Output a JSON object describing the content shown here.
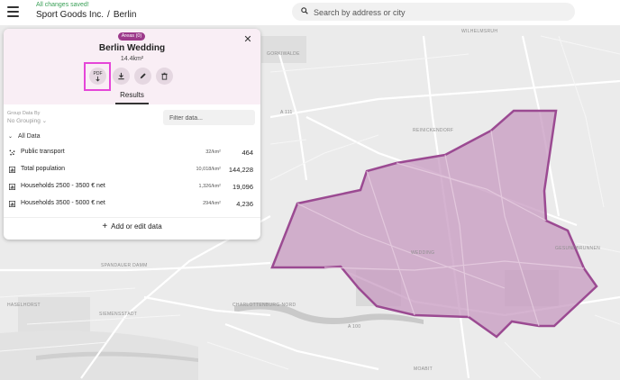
{
  "header": {
    "status": "All changes saved!",
    "company": "Sport Goods Inc.",
    "separator": "/",
    "location": "Berlin",
    "search_placeholder": "Search by address or city"
  },
  "panel": {
    "chip": "Areas (0)",
    "title": "Berlin Wedding",
    "area": "14.4km²",
    "pdf_label": "PDF",
    "tab": "Results",
    "group_label": "Group Data By",
    "group_value": "No Grouping",
    "filter_placeholder": "Filter data...",
    "all_data": "All Data",
    "rows": [
      {
        "label": "Public transport",
        "density": "32/km²",
        "value": "464",
        "icon": "transit-icon"
      },
      {
        "label": "Total population",
        "density": "10,018/km²",
        "value": "144,228",
        "icon": "chart-icon"
      },
      {
        "label": "Households 2500 - 3500 € net",
        "density": "1,326/km²",
        "value": "19,096",
        "icon": "chart-icon"
      },
      {
        "label": "Households 3500 - 5000 € net",
        "density": "294/km²",
        "value": "4,236",
        "icon": "chart-icon"
      }
    ],
    "add_label": "Add or edit data"
  },
  "map": {
    "labels": [
      "WILHELMSRUH",
      "GESUNDBRUNNEN",
      "WEDDING",
      "REINICKENDORF",
      "HASELHORST",
      "SIEMENSSTADT",
      "CHARLOTTENBURG-NORD",
      "MOABIT",
      "SPANDAUER DAMM",
      "A 100",
      "A 111",
      "GORKIWALDE"
    ]
  },
  "colors": {
    "accent": "#9d3a8b",
    "saved": "#3aa057",
    "highlight": "#e546d8",
    "polygon_fill": "#c79ac0",
    "polygon_stroke": "#9b4a92"
  }
}
